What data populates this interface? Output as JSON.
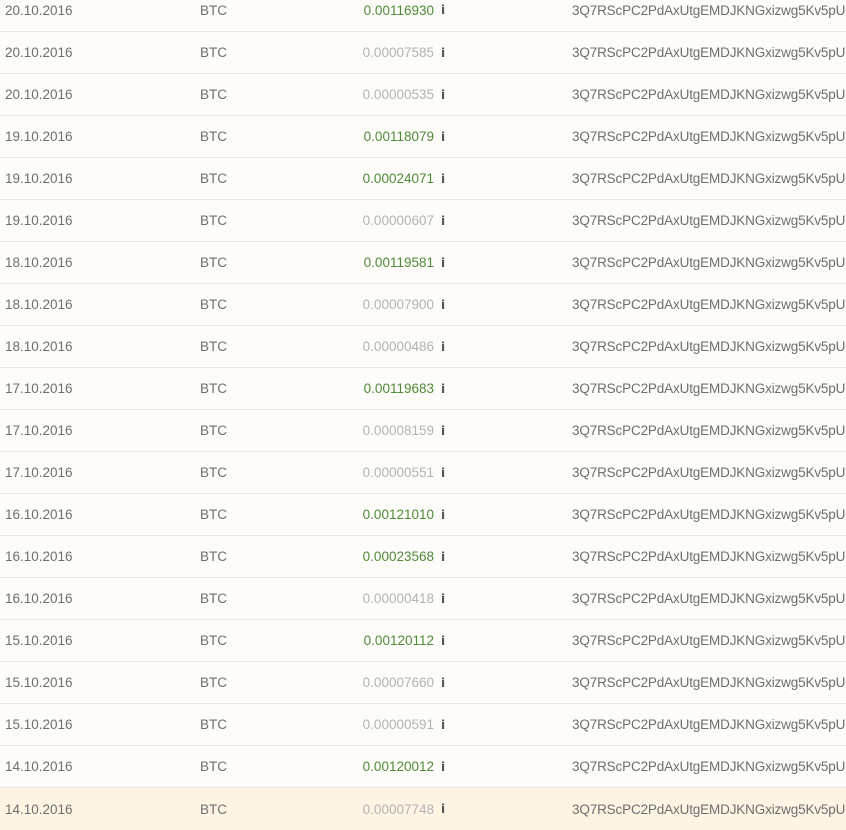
{
  "colors": {
    "background": "#fdfcf8",
    "row_highlight": "#fdf4e4",
    "amount_large": "#4f8a3a",
    "amount_small": "#b3b3b3",
    "text": "#6e6e6e"
  },
  "transactions": [
    {
      "date": "20.10.2016",
      "currency": "BTC",
      "amount": "0.00116930",
      "amount_style": "green",
      "info_icon": "i",
      "address": "3Q7RScPC2PdAxUtgEMDJKNGxizwg5Kv5pU"
    },
    {
      "date": "20.10.2016",
      "currency": "BTC",
      "amount": "0.00007585",
      "amount_style": "gray",
      "info_icon": "i",
      "address": "3Q7RScPC2PdAxUtgEMDJKNGxizwg5Kv5pU"
    },
    {
      "date": "20.10.2016",
      "currency": "BTC",
      "amount": "0.00000535",
      "amount_style": "gray",
      "info_icon": "i",
      "address": "3Q7RScPC2PdAxUtgEMDJKNGxizwg5Kv5pU"
    },
    {
      "date": "19.10.2016",
      "currency": "BTC",
      "amount": "0.00118079",
      "amount_style": "green",
      "info_icon": "i",
      "address": "3Q7RScPC2PdAxUtgEMDJKNGxizwg5Kv5pU"
    },
    {
      "date": "19.10.2016",
      "currency": "BTC",
      "amount": "0.00024071",
      "amount_style": "green",
      "info_icon": "i",
      "address": "3Q7RScPC2PdAxUtgEMDJKNGxizwg5Kv5pU"
    },
    {
      "date": "19.10.2016",
      "currency": "BTC",
      "amount": "0.00000607",
      "amount_style": "gray",
      "info_icon": "i",
      "address": "3Q7RScPC2PdAxUtgEMDJKNGxizwg5Kv5pU"
    },
    {
      "date": "18.10.2016",
      "currency": "BTC",
      "amount": "0.00119581",
      "amount_style": "green",
      "info_icon": "i",
      "address": "3Q7RScPC2PdAxUtgEMDJKNGxizwg5Kv5pU"
    },
    {
      "date": "18.10.2016",
      "currency": "BTC",
      "amount": "0.00007900",
      "amount_style": "gray",
      "info_icon": "i",
      "address": "3Q7RScPC2PdAxUtgEMDJKNGxizwg5Kv5pU"
    },
    {
      "date": "18.10.2016",
      "currency": "BTC",
      "amount": "0.00000486",
      "amount_style": "gray",
      "info_icon": "i",
      "address": "3Q7RScPC2PdAxUtgEMDJKNGxizwg5Kv5pU"
    },
    {
      "date": "17.10.2016",
      "currency": "BTC",
      "amount": "0.00119683",
      "amount_style": "green",
      "info_icon": "i",
      "address": "3Q7RScPC2PdAxUtgEMDJKNGxizwg5Kv5pU"
    },
    {
      "date": "17.10.2016",
      "currency": "BTC",
      "amount": "0.00008159",
      "amount_style": "gray",
      "info_icon": "i",
      "address": "3Q7RScPC2PdAxUtgEMDJKNGxizwg5Kv5pU"
    },
    {
      "date": "17.10.2016",
      "currency": "BTC",
      "amount": "0.00000551",
      "amount_style": "gray",
      "info_icon": "i",
      "address": "3Q7RScPC2PdAxUtgEMDJKNGxizwg5Kv5pU"
    },
    {
      "date": "16.10.2016",
      "currency": "BTC",
      "amount": "0.00121010",
      "amount_style": "green",
      "info_icon": "i",
      "address": "3Q7RScPC2PdAxUtgEMDJKNGxizwg5Kv5pU"
    },
    {
      "date": "16.10.2016",
      "currency": "BTC",
      "amount": "0.00023568",
      "amount_style": "green",
      "info_icon": "i",
      "address": "3Q7RScPC2PdAxUtgEMDJKNGxizwg5Kv5pU"
    },
    {
      "date": "16.10.2016",
      "currency": "BTC",
      "amount": "0.00000418",
      "amount_style": "gray",
      "info_icon": "i",
      "address": "3Q7RScPC2PdAxUtgEMDJKNGxizwg5Kv5pU"
    },
    {
      "date": "15.10.2016",
      "currency": "BTC",
      "amount": "0.00120112",
      "amount_style": "green",
      "info_icon": "i",
      "address": "3Q7RScPC2PdAxUtgEMDJKNGxizwg5Kv5pU"
    },
    {
      "date": "15.10.2016",
      "currency": "BTC",
      "amount": "0.00007660",
      "amount_style": "gray",
      "info_icon": "i",
      "address": "3Q7RScPC2PdAxUtgEMDJKNGxizwg5Kv5pU"
    },
    {
      "date": "15.10.2016",
      "currency": "BTC",
      "amount": "0.00000591",
      "amount_style": "gray",
      "info_icon": "i",
      "address": "3Q7RScPC2PdAxUtgEMDJKNGxizwg5Kv5pU"
    },
    {
      "date": "14.10.2016",
      "currency": "BTC",
      "amount": "0.00120012",
      "amount_style": "green",
      "info_icon": "i",
      "address": "3Q7RScPC2PdAxUtgEMDJKNGxizwg5Kv5pU"
    },
    {
      "date": "14.10.2016",
      "currency": "BTC",
      "amount": "0.00007748",
      "amount_style": "gray",
      "info_icon": "i",
      "address": "3Q7RScPC2PdAxUtgEMDJKNGxizwg5Kv5pU",
      "highlighted": true
    }
  ]
}
